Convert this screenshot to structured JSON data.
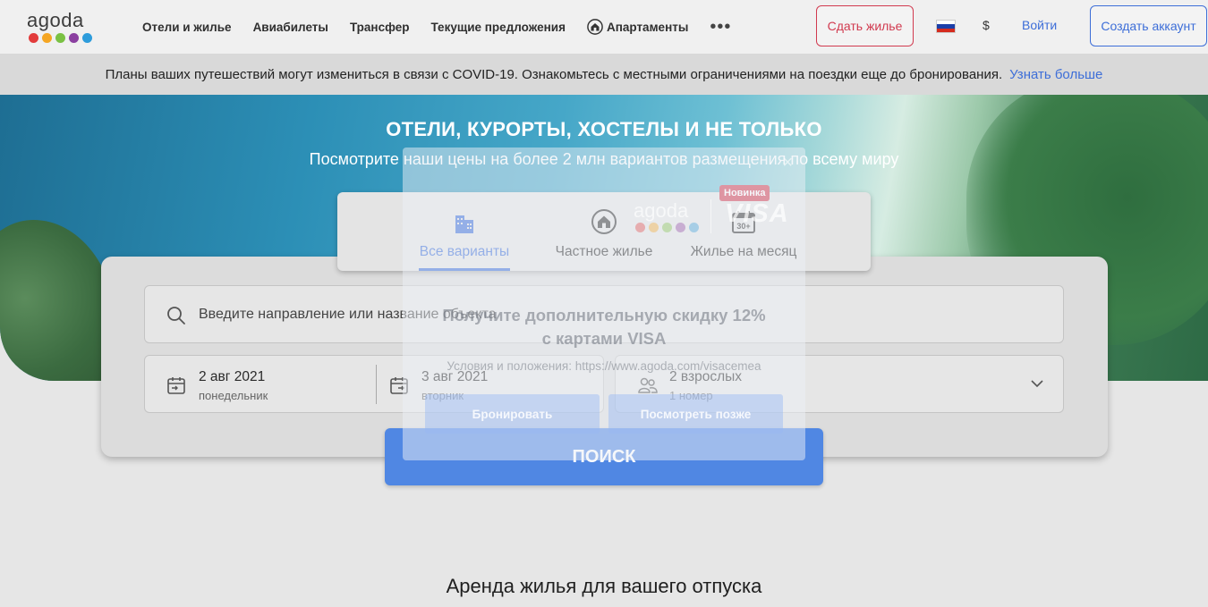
{
  "header": {
    "logo_text": "agoda",
    "logo_dot_colors": [
      "#e23b3b",
      "#f5a623",
      "#7ac143",
      "#8b3fa0",
      "#2d9cdb"
    ],
    "nav": [
      {
        "label": "Отели и жилье"
      },
      {
        "label": "Авиабилеты"
      },
      {
        "label": "Трансфер"
      },
      {
        "label": "Текущие предложения"
      },
      {
        "label": "Апартаменты",
        "icon": "home-icon"
      }
    ],
    "more_label": "•••",
    "host_button": "Сдать жилье",
    "currency": "$",
    "login": "Войти",
    "create_account": "Создать аккаунт",
    "flag": "russia-flag-icon"
  },
  "covid_banner": {
    "text": "Планы ваших путешествий могут измениться в связи с COVID-19. Ознакомьтесь с местными ограничениями на поездки еще до бронирования.",
    "link": "Узнать больше"
  },
  "hero": {
    "title": "ОТЕЛИ, КУРОРТЫ, ХОСТЕЛЫ И НЕ ТОЛЬКО",
    "subtitle": "Посмотрите наши цены на более 2 млн вариантов размещения по всему миру"
  },
  "tabs": [
    {
      "label": "Все варианты",
      "icon": "buildings-icon",
      "active": true
    },
    {
      "label": "Частное жилье",
      "icon": "home-icon",
      "active": false
    },
    {
      "label": "Жилье на месяц",
      "icon": "calendar-30-icon",
      "active": false,
      "badge": "Новинка"
    }
  ],
  "search": {
    "destination_placeholder": "Введите направление или название объекта",
    "checkin": {
      "date": "2 авг 2021",
      "weekday": "понедельник"
    },
    "checkout": {
      "date": "3 авг 2021",
      "weekday": "вторник"
    },
    "guests": {
      "main": "2 взрослых",
      "sub": "1 номер"
    },
    "search_button": "ПОИСК"
  },
  "promo": {
    "logo_text": "agoda",
    "visa_text": "VISA",
    "close": "×",
    "title_line1": "Получите дополнительную скидку 12%",
    "title_line2": "с картами VISA",
    "terms": "Условия и положения: https://www.agoda.com/visacemea",
    "book_button": "Бронировать",
    "later_button": "Посмотреть позже"
  },
  "section_title": "Аренда жилья для вашего отпуска",
  "colors": {
    "accent": "#3d6ed8",
    "brand_red": "#d13a4f",
    "search_button": "#5087e3"
  }
}
